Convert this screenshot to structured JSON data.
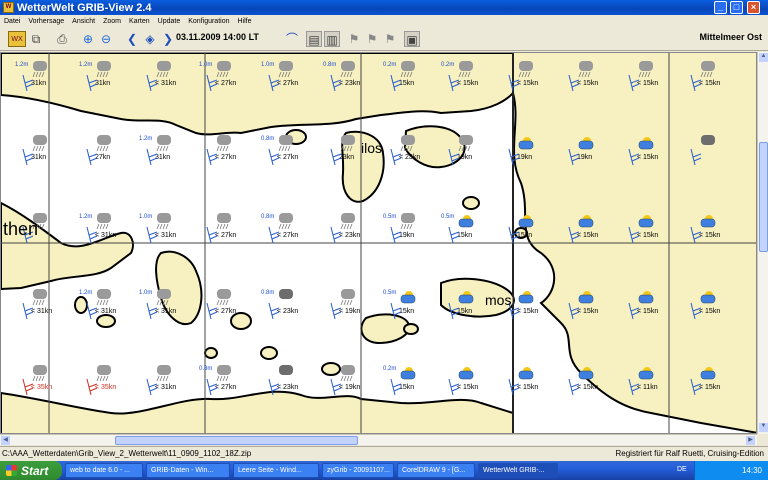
{
  "window": {
    "title": "WetterWelt GRIB-View 2.4",
    "icon": "grib-app-icon",
    "controls": [
      "_",
      "□",
      "×"
    ]
  },
  "menu": {
    "items": [
      "Datei",
      "Vorhersage",
      "Ansicht",
      "Zoom",
      "Karten",
      "Update",
      "Konfiguration",
      "Hilfe"
    ]
  },
  "toolbar": {
    "datetime": "03.11.2009 14:00 LT",
    "region": "Mittelmeer Ost"
  },
  "map": {
    "labels": [
      {
        "text": "then"
      },
      {
        "text": "ilos"
      },
      {
        "text": "mos"
      }
    ],
    "colors": {
      "sea": "#ffffff",
      "land": "#f7f0c0",
      "grid": "#444444",
      "wind": "#2a5fd0",
      "strong_wind": "#d03020"
    },
    "stations": [
      [
        {
          "wave": "1.2m",
          "wind": "31kn",
          "icon": "rain"
        },
        {
          "wave": "1.2m",
          "wind": "31kn",
          "icon": "rain"
        },
        {
          "wave": "",
          "wind": "< 31kn",
          "icon": "rain"
        },
        {
          "wave": "1.0m",
          "wind": "< 27kn",
          "icon": "rain"
        },
        {
          "wave": "1.0m",
          "wind": "< 27kn",
          "icon": "rain"
        },
        {
          "wave": "0.8m",
          "wind": "< 23kn",
          "icon": "rain"
        },
        {
          "wave": "0.2m",
          "wind": "15kn",
          "icon": "rain"
        },
        {
          "wave": "0.2m",
          "wind": "< 15kn",
          "icon": "rain"
        },
        {
          "wave": "",
          "wind": "< 15kn",
          "icon": "rain"
        },
        {
          "wave": "",
          "wind": "< 15kn",
          "icon": "rain"
        },
        {
          "wave": "",
          "wind": "< 15kn",
          "icon": "rain"
        },
        {
          "wave": "",
          "wind": "< 15kn",
          "icon": "rain"
        }
      ],
      [
        {
          "wave": "",
          "wind": "31kn",
          "icon": "rain"
        },
        {
          "wave": "",
          "wind": "27kn",
          "icon": "rain"
        },
        {
          "wave": "1.2m",
          "wind": "31kn",
          "icon": "rain"
        },
        {
          "wave": "",
          "wind": "< 27kn",
          "icon": "rain"
        },
        {
          "wave": "0.8m",
          "wind": "< 27kn",
          "icon": "rain"
        },
        {
          "wave": "",
          "wind": "23kn",
          "icon": "rain"
        },
        {
          "wave": "",
          "wind": "< 23kn",
          "icon": "rain"
        },
        {
          "wave": "",
          "wind": "19kn",
          "icon": "rain"
        },
        {
          "wave": "",
          "wind": "19kn",
          "icon": "sun-cloud"
        },
        {
          "wave": "",
          "wind": "19kn",
          "icon": "sun-cloud"
        },
        {
          "wave": "",
          "wind": "< 15kn",
          "icon": "sun-cloud"
        },
        {
          "wave": "",
          "wind": "",
          "icon": "cloud"
        }
      ],
      [
        {
          "wave": "",
          "wind": "",
          "icon": "rain"
        },
        {
          "wave": "1.2m",
          "wind": "< 31kn",
          "icon": "rain"
        },
        {
          "wave": "1.0m",
          "wind": "< 31kn",
          "icon": "rain"
        },
        {
          "wave": "",
          "wind": "< 27kn",
          "icon": "rain"
        },
        {
          "wave": "0.8m",
          "wind": "< 27kn",
          "icon": "rain"
        },
        {
          "wave": "",
          "wind": "< 23kn",
          "icon": "rain"
        },
        {
          "wave": "0.5m",
          "wind": "19kn",
          "icon": "rain"
        },
        {
          "wave": "0.5m",
          "wind": "15kn",
          "icon": "sun-cloud"
        },
        {
          "wave": "",
          "wind": "15kn",
          "icon": "sun-cloud"
        },
        {
          "wave": "",
          "wind": "< 15kn",
          "icon": "sun-cloud"
        },
        {
          "wave": "",
          "wind": "< 15kn",
          "icon": "sun-cloud"
        },
        {
          "wave": "",
          "wind": "< 15kn",
          "icon": "sun-cloud"
        }
      ],
      [
        {
          "wave": "",
          "wind": "< 31kn",
          "icon": "rain"
        },
        {
          "wave": "1.2m",
          "wind": "< 31kn",
          "icon": "rain"
        },
        {
          "wave": "1.0m",
          "wind": "< 31kn",
          "icon": "rain"
        },
        {
          "wave": "",
          "wind": "< 27kn",
          "icon": "rain"
        },
        {
          "wave": "0.8m",
          "wind": "< 23kn",
          "icon": "cloud"
        },
        {
          "wave": "",
          "wind": "< 19kn",
          "icon": "rain"
        },
        {
          "wave": "0.5m",
          "wind": "15kn",
          "icon": "sun-cloud"
        },
        {
          "wave": "",
          "wind": "15kn",
          "icon": "sun-cloud"
        },
        {
          "wave": "",
          "wind": "< 15kn",
          "icon": "sun-cloud"
        },
        {
          "wave": "",
          "wind": "< 15kn",
          "icon": "sun-cloud"
        },
        {
          "wave": "",
          "wind": "< 15kn",
          "icon": "sun-cloud"
        },
        {
          "wave": "",
          "wind": "< 15kn",
          "icon": "sun-cloud"
        }
      ],
      [
        {
          "wave": "",
          "wind": "< 35kn",
          "icon": "rain",
          "strong": true
        },
        {
          "wave": "",
          "wind": "< 35kn",
          "icon": "rain",
          "strong": true
        },
        {
          "wave": "",
          "wind": "< 31kn",
          "icon": "rain"
        },
        {
          "wave": "0.8m",
          "wind": "< 27kn",
          "icon": "rain"
        },
        {
          "wave": "",
          "wind": "< 23kn",
          "icon": "cloud"
        },
        {
          "wave": "",
          "wind": "< 19kn",
          "icon": "rain"
        },
        {
          "wave": "0.2m",
          "wind": "15kn",
          "icon": "sun-cloud"
        },
        {
          "wave": "",
          "wind": "< 15kn",
          "icon": "sun-cloud"
        },
        {
          "wave": "",
          "wind": "< 15kn",
          "icon": "sun-cloud"
        },
        {
          "wave": "",
          "wind": "< 15kn",
          "icon": "sun-cloud"
        },
        {
          "wave": "",
          "wind": "< 11kn",
          "icon": "sun-cloud"
        },
        {
          "wave": "",
          "wind": "< 15kn",
          "icon": "sun-cloud"
        }
      ]
    ]
  },
  "status": {
    "path": "C:\\AAA_Wetterdaten\\Grib_View_2_Wetterwelt\\11_0909_1102_18Z.zip",
    "registration": "Registriert für Ralf Ruetti, Cruising-Edition"
  },
  "taskbar": {
    "start_label": "Start",
    "tasks": [
      "web to date 6.0 - ...",
      "GRIB-Daten - Win...",
      "Leere Seite - Wind...",
      "zyGrib - 20091107...",
      "CorelDRAW 9 - [G...",
      "WetterWelt GRIB-..."
    ],
    "language": "DE",
    "clock": "14:30"
  }
}
